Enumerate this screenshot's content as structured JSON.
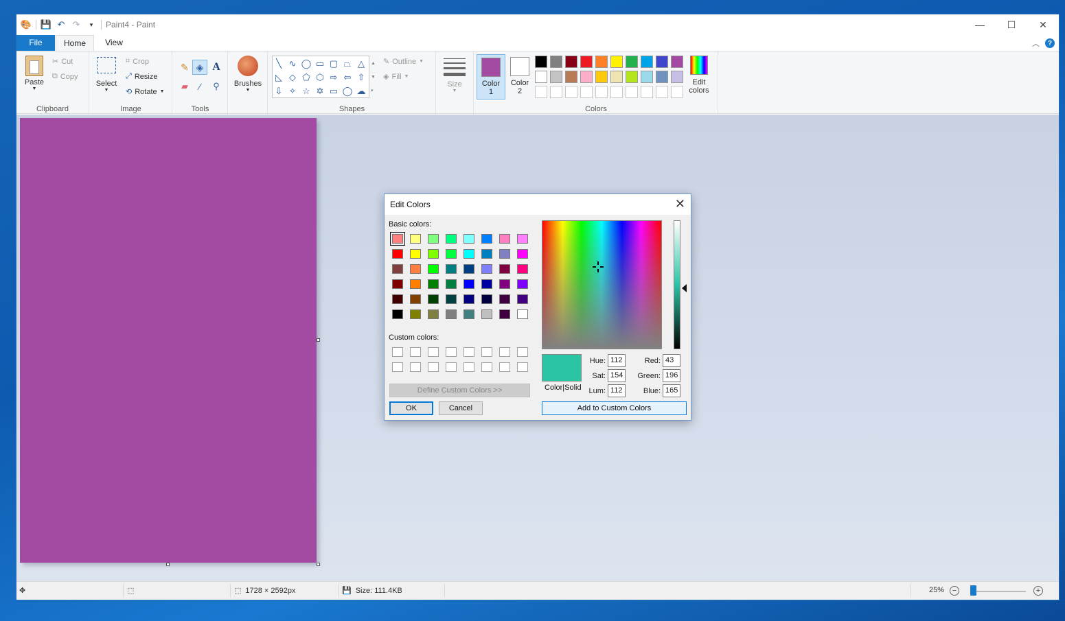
{
  "window": {
    "title": "Paint4 - Paint",
    "controls": {
      "minimize": "—",
      "maximize": "☐",
      "close": "✕"
    }
  },
  "tabs": {
    "file": "File",
    "home": "Home",
    "view": "View"
  },
  "ribbon": {
    "clipboard": {
      "label": "Clipboard",
      "paste": "Paste",
      "cut": "Cut",
      "copy": "Copy"
    },
    "image": {
      "label": "Image",
      "select": "Select",
      "crop": "Crop",
      "resize": "Resize",
      "rotate": "Rotate"
    },
    "tools": {
      "label": "Tools"
    },
    "brushes": {
      "label": "Brushes"
    },
    "shapes": {
      "label": "Shapes",
      "outline": "Outline",
      "fill": "Fill"
    },
    "size": {
      "label": "Size"
    },
    "colors": {
      "label": "Colors",
      "color1": "Color",
      "color1_num": "1",
      "color2": "Color",
      "color2_num": "2",
      "color1_value": "#a34ba3",
      "color2_value": "#ffffff",
      "edit": "Edit",
      "edit2": "colors",
      "palette_row1": [
        "#000000",
        "#7f7f7f",
        "#880015",
        "#ed1c24",
        "#ff7f27",
        "#fff200",
        "#22b14c",
        "#00a2e8",
        "#3f48cc",
        "#a349a4"
      ],
      "palette_row2": [
        "#ffffff",
        "#c3c3c3",
        "#b97a57",
        "#ffaec9",
        "#ffc90e",
        "#efe4b0",
        "#b5e61d",
        "#99d9ea",
        "#7092be",
        "#c8bfe7"
      ]
    }
  },
  "canvas": {
    "color": "#a34ba3"
  },
  "status": {
    "dimensions": "1728 × 2592px",
    "size": "Size: 111.4KB",
    "zoom": "25%"
  },
  "dialog": {
    "title": "Edit Colors",
    "basic_label": "Basic colors:",
    "custom_label": "Custom colors:",
    "define_button": "Define Custom Colors >>",
    "ok": "OK",
    "cancel": "Cancel",
    "add_button": "Add to Custom Colors",
    "color_solid": "Color|Solid",
    "preview_color": "#2bc4a5",
    "hue_label": "Hue:",
    "hue": "112",
    "sat_label": "Sat:",
    "sat": "154",
    "lum_label": "Lum:",
    "lum": "112",
    "red_label": "Red:",
    "red": "43",
    "green_label": "Green:",
    "green": "196",
    "blue_label": "Blue:",
    "blue": "165",
    "basic_colors": [
      [
        "#ff8080",
        "#ffff80",
        "#80ff80",
        "#00ff80",
        "#80ffff",
        "#0080ff",
        "#ff80c0",
        "#ff80ff"
      ],
      [
        "#ff0000",
        "#ffff00",
        "#80ff00",
        "#00ff40",
        "#00ffff",
        "#0080c0",
        "#8080c0",
        "#ff00ff"
      ],
      [
        "#804040",
        "#ff8040",
        "#00ff00",
        "#008080",
        "#004080",
        "#8080ff",
        "#800040",
        "#ff0080"
      ],
      [
        "#800000",
        "#ff8000",
        "#008000",
        "#008040",
        "#0000ff",
        "#0000a0",
        "#800080",
        "#8000ff"
      ],
      [
        "#400000",
        "#804000",
        "#004000",
        "#004040",
        "#000080",
        "#000040",
        "#400040",
        "#400080"
      ],
      [
        "#000000",
        "#808000",
        "#808040",
        "#808080",
        "#408080",
        "#c0c0c0",
        "#400040",
        "#ffffff"
      ]
    ]
  }
}
